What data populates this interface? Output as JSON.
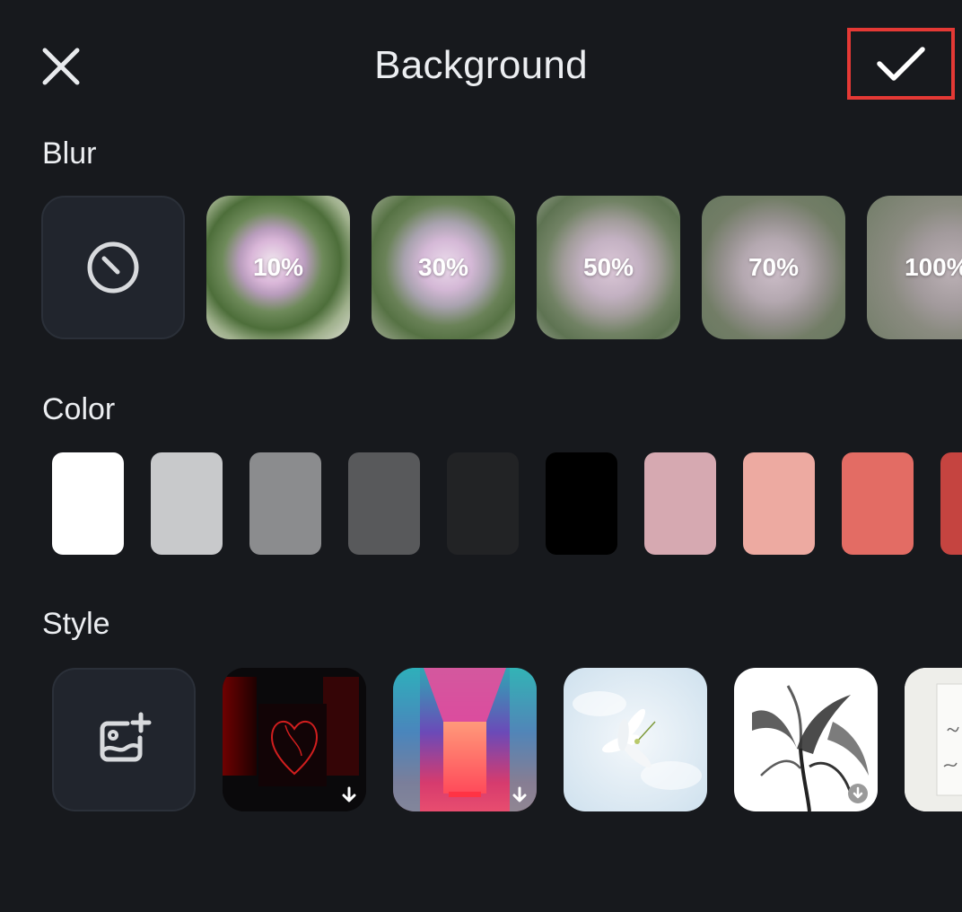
{
  "header": {
    "title": "Background",
    "close_icon": "close-icon",
    "confirm_icon": "checkmark-icon"
  },
  "sections": {
    "blur": {
      "label": "Blur",
      "none_icon": "no-blur-icon",
      "options": [
        {
          "label": "10%"
        },
        {
          "label": "30%"
        },
        {
          "label": "50%"
        },
        {
          "label": "70%"
        },
        {
          "label": "100%"
        }
      ]
    },
    "color": {
      "label": "Color",
      "swatches": [
        "#ffffff",
        "#c8c9cb",
        "#8b8c8e",
        "#58595b",
        "#222325",
        "#000000",
        "#d6a9b1",
        "#edaaa1",
        "#e36c64",
        "#c54440"
      ]
    },
    "style": {
      "label": "Style",
      "add_icon": "add-image-icon",
      "items": [
        {
          "name": "red-heart-neon",
          "download_icon": "download-arrow-icon"
        },
        {
          "name": "neon-corridor",
          "download_icon": "download-arrow-icon"
        },
        {
          "name": "white-lily-sky"
        },
        {
          "name": "lily-xray",
          "download_icon": "download-circle-icon"
        },
        {
          "name": "handwritten-card"
        }
      ]
    }
  },
  "colors": {
    "background": "#17191d",
    "accent_highlight": "#e53935",
    "tile_bg": "#21252d"
  }
}
